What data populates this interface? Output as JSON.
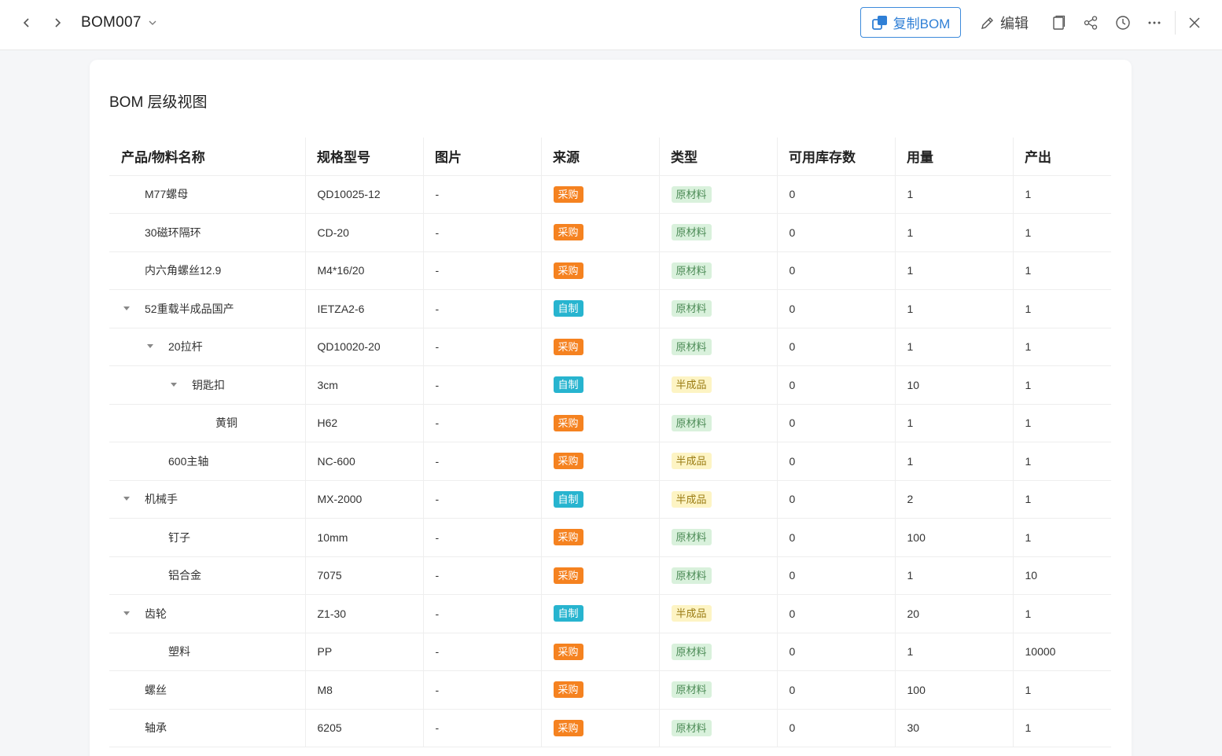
{
  "header": {
    "title": "BOM007",
    "copy_bom_label": "复制BOM",
    "edit_label": "编辑"
  },
  "card": {
    "title": "BOM 层级视图"
  },
  "table": {
    "columns": [
      "产品/物料名称",
      "规格型号",
      "图片",
      "来源",
      "类型",
      "可用库存数",
      "用量",
      "产出"
    ],
    "rows": [
      {
        "level": 1,
        "expandable": false,
        "name": "M77螺母",
        "spec": "QD10025-12",
        "image": "-",
        "source": "采购",
        "type": "原材料",
        "stock": "0",
        "usage": "1",
        "output": "1"
      },
      {
        "level": 1,
        "expandable": false,
        "name": "30磁环隔环",
        "spec": "CD-20",
        "image": "-",
        "source": "采购",
        "type": "原材料",
        "stock": "0",
        "usage": "1",
        "output": "1"
      },
      {
        "level": 1,
        "expandable": false,
        "name": "内六角螺丝12.9",
        "spec": "M4*16/20",
        "image": "-",
        "source": "采购",
        "type": "原材料",
        "stock": "0",
        "usage": "1",
        "output": "1"
      },
      {
        "level": 1,
        "expandable": true,
        "name": "52重载半成品国产",
        "spec": "IETZA2-6",
        "image": "-",
        "source": "自制",
        "type": "原材料",
        "stock": "0",
        "usage": "1",
        "output": "1"
      },
      {
        "level": 2,
        "expandable": true,
        "name": "20拉杆",
        "spec": "QD10020-20",
        "image": "-",
        "source": "采购",
        "type": "原材料",
        "stock": "0",
        "usage": "1",
        "output": "1"
      },
      {
        "level": 3,
        "expandable": true,
        "name": "钥匙扣",
        "spec": "3cm",
        "image": "-",
        "source": "自制",
        "type": "半成品",
        "stock": "0",
        "usage": "10",
        "output": "1"
      },
      {
        "level": 4,
        "expandable": false,
        "name": "黄铜",
        "spec": "H62",
        "image": "-",
        "source": "采购",
        "type": "原材料",
        "stock": "0",
        "usage": "1",
        "output": "1"
      },
      {
        "level": 2,
        "expandable": false,
        "name": "600主轴",
        "spec": "NC-600",
        "image": "-",
        "source": "采购",
        "type": "半成品",
        "stock": "0",
        "usage": "1",
        "output": "1"
      },
      {
        "level": 1,
        "expandable": true,
        "name": "机械手",
        "spec": "MX-2000",
        "image": "-",
        "source": "自制",
        "type": "半成品",
        "stock": "0",
        "usage": "2",
        "output": "1"
      },
      {
        "level": 2,
        "expandable": false,
        "name": "钉子",
        "spec": "10mm",
        "image": "-",
        "source": "采购",
        "type": "原材料",
        "stock": "0",
        "usage": "100",
        "output": "1"
      },
      {
        "level": 2,
        "expandable": false,
        "name": "铝合金",
        "spec": "7075",
        "image": "-",
        "source": "采购",
        "type": "原材料",
        "stock": "0",
        "usage": "1",
        "output": "10"
      },
      {
        "level": 1,
        "expandable": true,
        "name": "齿轮",
        "spec": "Z1-30",
        "image": "-",
        "source": "自制",
        "type": "半成品",
        "stock": "0",
        "usage": "20",
        "output": "1"
      },
      {
        "level": 2,
        "expandable": false,
        "name": "塑料",
        "spec": "PP",
        "image": "-",
        "source": "采购",
        "type": "原材料",
        "stock": "0",
        "usage": "1",
        "output": "10000"
      },
      {
        "level": 1,
        "expandable": false,
        "name": "螺丝",
        "spec": "M8",
        "image": "-",
        "source": "采购",
        "type": "原材料",
        "stock": "0",
        "usage": "100",
        "output": "1"
      },
      {
        "level": 1,
        "expandable": false,
        "name": "轴承",
        "spec": "6205",
        "image": "-",
        "source": "采购",
        "type": "原材料",
        "stock": "0",
        "usage": "30",
        "output": "1"
      }
    ]
  },
  "icons": {
    "back": "chevron-left-icon",
    "forward": "chevron-right-icon",
    "title_dropdown": "chevron-down-icon",
    "copy_bom": "copy-stack-icon",
    "edit": "pencil-icon",
    "copy": "copy-icon",
    "share": "share-icon",
    "history": "clock-icon",
    "more": "more-dots-icon",
    "close": "close-icon",
    "expand": "caret-down-icon"
  },
  "colors": {
    "source_buy": "#f58220",
    "source_self": "#27b4cf",
    "type_raw_bg": "#d9f1dc",
    "type_semi_bg": "#fdf4c4",
    "accent": "#2f7fd6"
  }
}
